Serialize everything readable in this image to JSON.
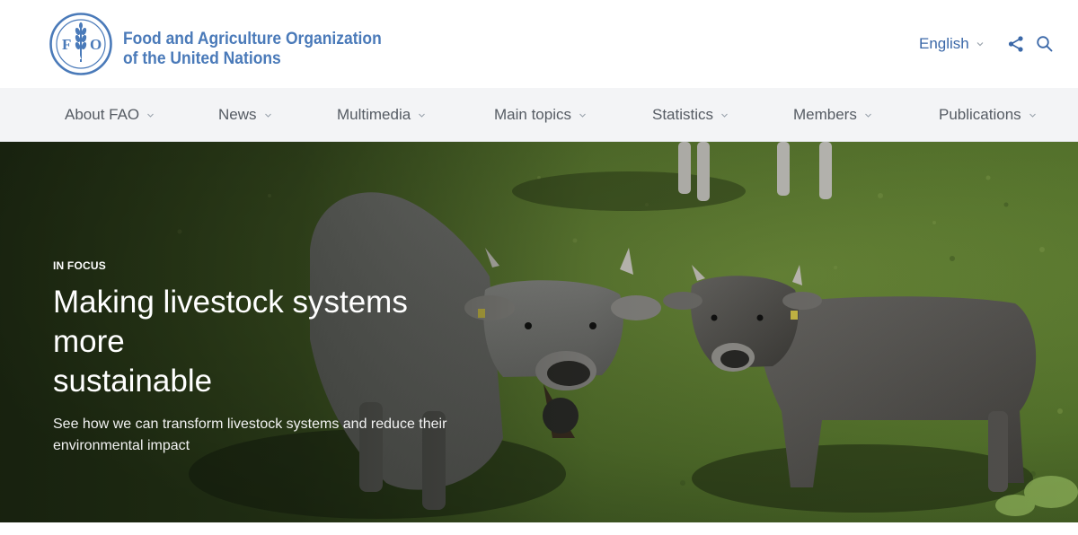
{
  "header": {
    "logo": {
      "letters": [
        "F",
        "A",
        "O"
      ],
      "motto": "FIAT PANIS",
      "color": "#4a7ab9"
    },
    "org_name_line1": "Food and Agriculture Organization",
    "org_name_line2": "of the United Nations",
    "language": "English",
    "icons": [
      "chevron-down-icon",
      "share-icon",
      "search-icon"
    ]
  },
  "nav": {
    "items": [
      {
        "label": "About FAO"
      },
      {
        "label": "News"
      },
      {
        "label": "Multimedia"
      },
      {
        "label": "Main topics"
      },
      {
        "label": "Statistics"
      },
      {
        "label": "Members"
      },
      {
        "label": "Publications"
      }
    ]
  },
  "hero": {
    "kicker": "IN FOCUS",
    "title_line1": "Making livestock systems more",
    "title_line2": "sustainable",
    "subtitle_line1": "See how we can transform livestock systems and reduce their",
    "subtitle_line2": "environmental impact"
  },
  "colors": {
    "brand": "#4a7ab9",
    "nav_bg": "#f3f4f6",
    "nav_text": "#555b63",
    "hero_text": "#ffffff"
  }
}
